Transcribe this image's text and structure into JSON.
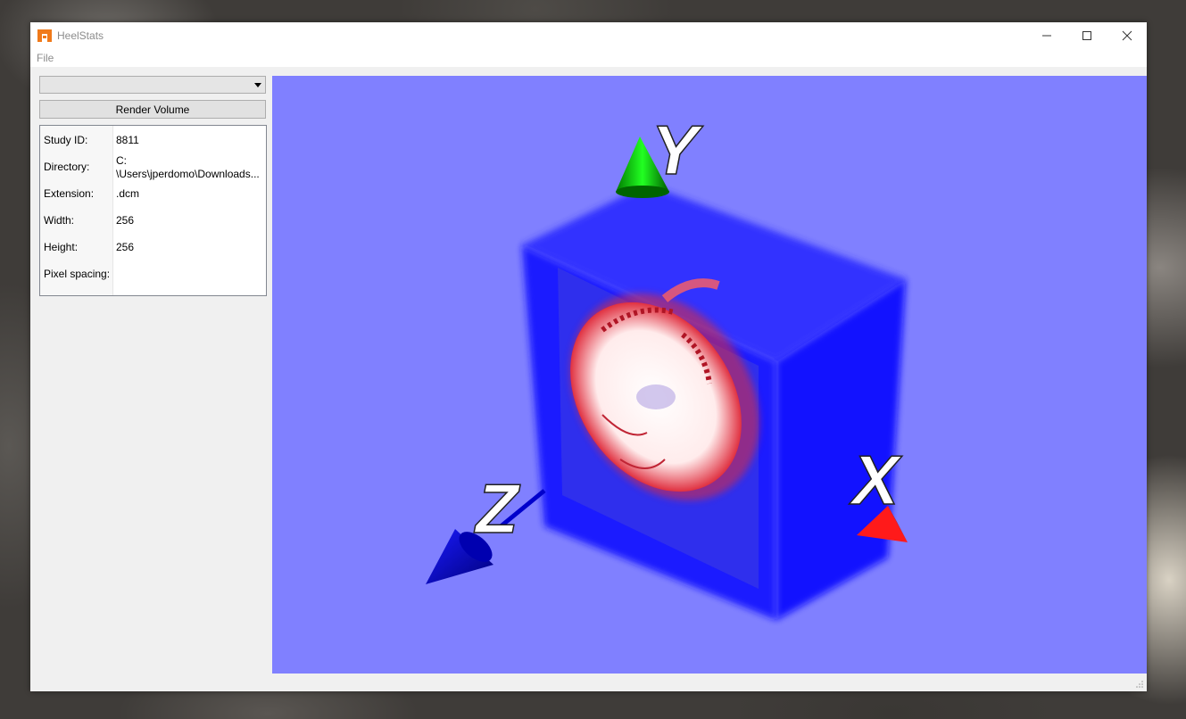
{
  "window": {
    "title": "HeelStats",
    "controls": {
      "minimize_icon": "minimize-icon",
      "maximize_icon": "maximize-icon",
      "close_icon": "close-icon"
    }
  },
  "menu": {
    "items": [
      "File"
    ]
  },
  "sidebar": {
    "dataset_select": {
      "value": ""
    },
    "render_button": "Render Volume",
    "info": {
      "rows": [
        {
          "label": "Study ID:",
          "value": "8811"
        },
        {
          "label": "Directory:",
          "value_line1": "C:",
          "value_line2": "\\Users\\jperdomo\\Downloads..."
        },
        {
          "label": "Extension:",
          "value": ".dcm"
        },
        {
          "label": "Width:",
          "value": "256"
        },
        {
          "label": "Height:",
          "value": "256"
        },
        {
          "label": "Pixel spacing:",
          "value": ""
        }
      ]
    }
  },
  "viewport": {
    "background": "#8080ff",
    "axes": {
      "x": "X",
      "y": "Y",
      "z": "Z"
    },
    "axis_colors": {
      "x": "#ff0000",
      "y": "#00c000",
      "z": "#0000ff"
    },
    "volume_color": "#0000ff"
  }
}
